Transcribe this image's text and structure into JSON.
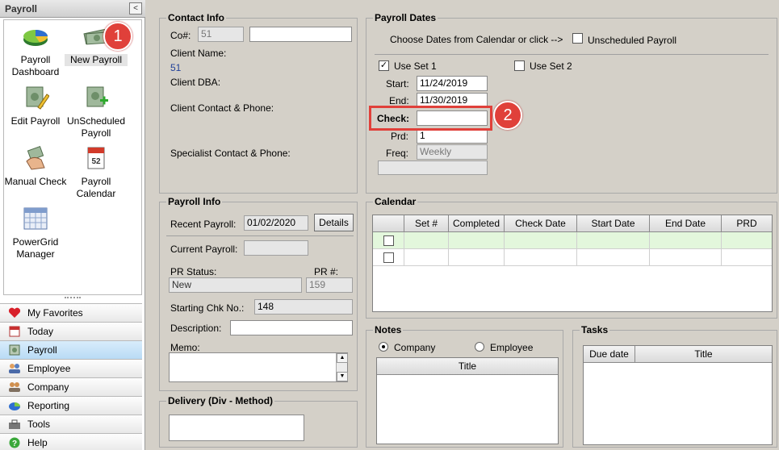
{
  "sidebar": {
    "title": "Payroll",
    "collapse_glyph": "<",
    "icons": [
      {
        "label": "Payroll Dashboard",
        "icon": "dashboard-pie-icon"
      },
      {
        "label": "New Payroll",
        "icon": "money-icon"
      },
      {
        "label": "Edit Payroll",
        "icon": "edit-money-icon"
      },
      {
        "label": "UnScheduled Payroll",
        "icon": "unscheduled-money-icon"
      },
      {
        "label": "Manual Check",
        "icon": "hand-money-icon"
      },
      {
        "label": "Payroll Calendar",
        "icon": "calendar-52-icon"
      },
      {
        "label": "PowerGrid Manager",
        "icon": "grid-icon"
      }
    ],
    "calendar_glyph": "52",
    "nav": [
      {
        "label": "My Favorites",
        "icon": "heart-icon"
      },
      {
        "label": "Today",
        "icon": "today-icon"
      },
      {
        "label": "Payroll",
        "icon": "payroll-icon"
      },
      {
        "label": "Employee",
        "icon": "employee-icon"
      },
      {
        "label": "Company",
        "icon": "company-icon"
      },
      {
        "label": "Reporting",
        "icon": "reporting-icon"
      },
      {
        "label": "Tools",
        "icon": "tools-icon"
      },
      {
        "label": "Help",
        "icon": "help-icon"
      }
    ]
  },
  "callouts": {
    "one": "1",
    "two": "2"
  },
  "contact_info": {
    "title": "Contact Info",
    "co_label": "Co#:",
    "co_value": "51",
    "co_name_value": "",
    "client_name_label": "Client Name:",
    "client_name_value": "51",
    "client_dba_label": "Client DBA:",
    "client_contact_label": "Client Contact & Phone:",
    "specialist_label": "Specialist Contact & Phone:"
  },
  "payroll_dates": {
    "title": "Payroll Dates",
    "choose_text": "Choose Dates from Calendar or click -->",
    "unscheduled_label": "Unscheduled Payroll",
    "use_set1_label": "Use Set 1",
    "use_set2_label": "Use Set 2",
    "check_mark": "✓",
    "start_label": "Start:",
    "start_value": "11/24/2019",
    "end_label": "End:",
    "end_value": "11/30/2019",
    "check_label": "Check:",
    "check_value": "",
    "prd_label": "Prd:",
    "prd_value": "1",
    "freq_label": "Freq:",
    "freq_value": "Weekly"
  },
  "payroll_info": {
    "title": "Payroll Info",
    "recent_label": "Recent Payroll:",
    "recent_value": "01/02/2020",
    "details_label": "Details",
    "current_label": "Current Payroll:",
    "current_value": "",
    "pr_status_label": "PR Status:",
    "pr_status_value": "New",
    "pr_num_label": "PR #:",
    "pr_num_value": "159",
    "starting_chk_label": "Starting Chk No.:",
    "starting_chk_value": "148",
    "description_label": "Description:",
    "memo_label": "Memo:"
  },
  "delivery": {
    "title": "Delivery (Div - Method)"
  },
  "calendar": {
    "title": "Calendar",
    "columns": [
      "",
      "Set #",
      "Completed",
      "Check Date",
      "Start Date",
      "End Date",
      "PRD"
    ]
  },
  "notes": {
    "title": "Notes",
    "company_label": "Company",
    "employee_label": "Employee",
    "col_title": "Title"
  },
  "tasks": {
    "title": "Tasks",
    "col_due": "Due date",
    "col_title": "Title"
  }
}
